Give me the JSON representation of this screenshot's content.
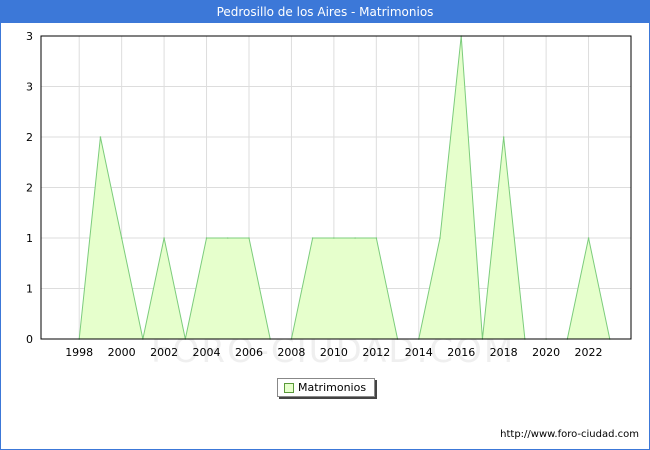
{
  "chart_data": {
    "type": "area",
    "title": "Pedrosillo de los Aires - Matrimonios",
    "x": [
      1998,
      1999,
      2000,
      2001,
      2002,
      2003,
      2004,
      2005,
      2006,
      2007,
      2008,
      2009,
      2010,
      2011,
      2012,
      2013,
      2014,
      2015,
      2016,
      2017,
      2018,
      2019,
      2020,
      2021,
      2022,
      2023
    ],
    "series": [
      {
        "name": "Matrimonios",
        "values": [
          0,
          2,
          1,
          0,
          1,
          0,
          1,
          1,
          1,
          0,
          0,
          1,
          1,
          1,
          1,
          0,
          0,
          1,
          3,
          0,
          2,
          0,
          0,
          0,
          1,
          0
        ]
      }
    ],
    "x_ticks": [
      "1998",
      "2000",
      "2002",
      "2004",
      "2006",
      "2008",
      "2010",
      "2012",
      "2014",
      "2016",
      "2018",
      "2020",
      "2022"
    ],
    "y_ticks": [
      "0",
      "1",
      "1",
      "2",
      "2",
      "3",
      "3"
    ],
    "y_tick_values": [
      0,
      0.5,
      1,
      1.5,
      2,
      2.5,
      3
    ],
    "xlim": [
      1996.2,
      2024
    ],
    "ylim": [
      0,
      3
    ],
    "grid": true,
    "legend_position": "bottom-center",
    "colors": {
      "fill": "#e6ffcc",
      "line": "#7ccc7c",
      "grid": "#dddddd",
      "header": "#3c78d8"
    }
  },
  "watermark": "FORO-CIUDAD.COM",
  "source": "http://www.foro-ciudad.com"
}
